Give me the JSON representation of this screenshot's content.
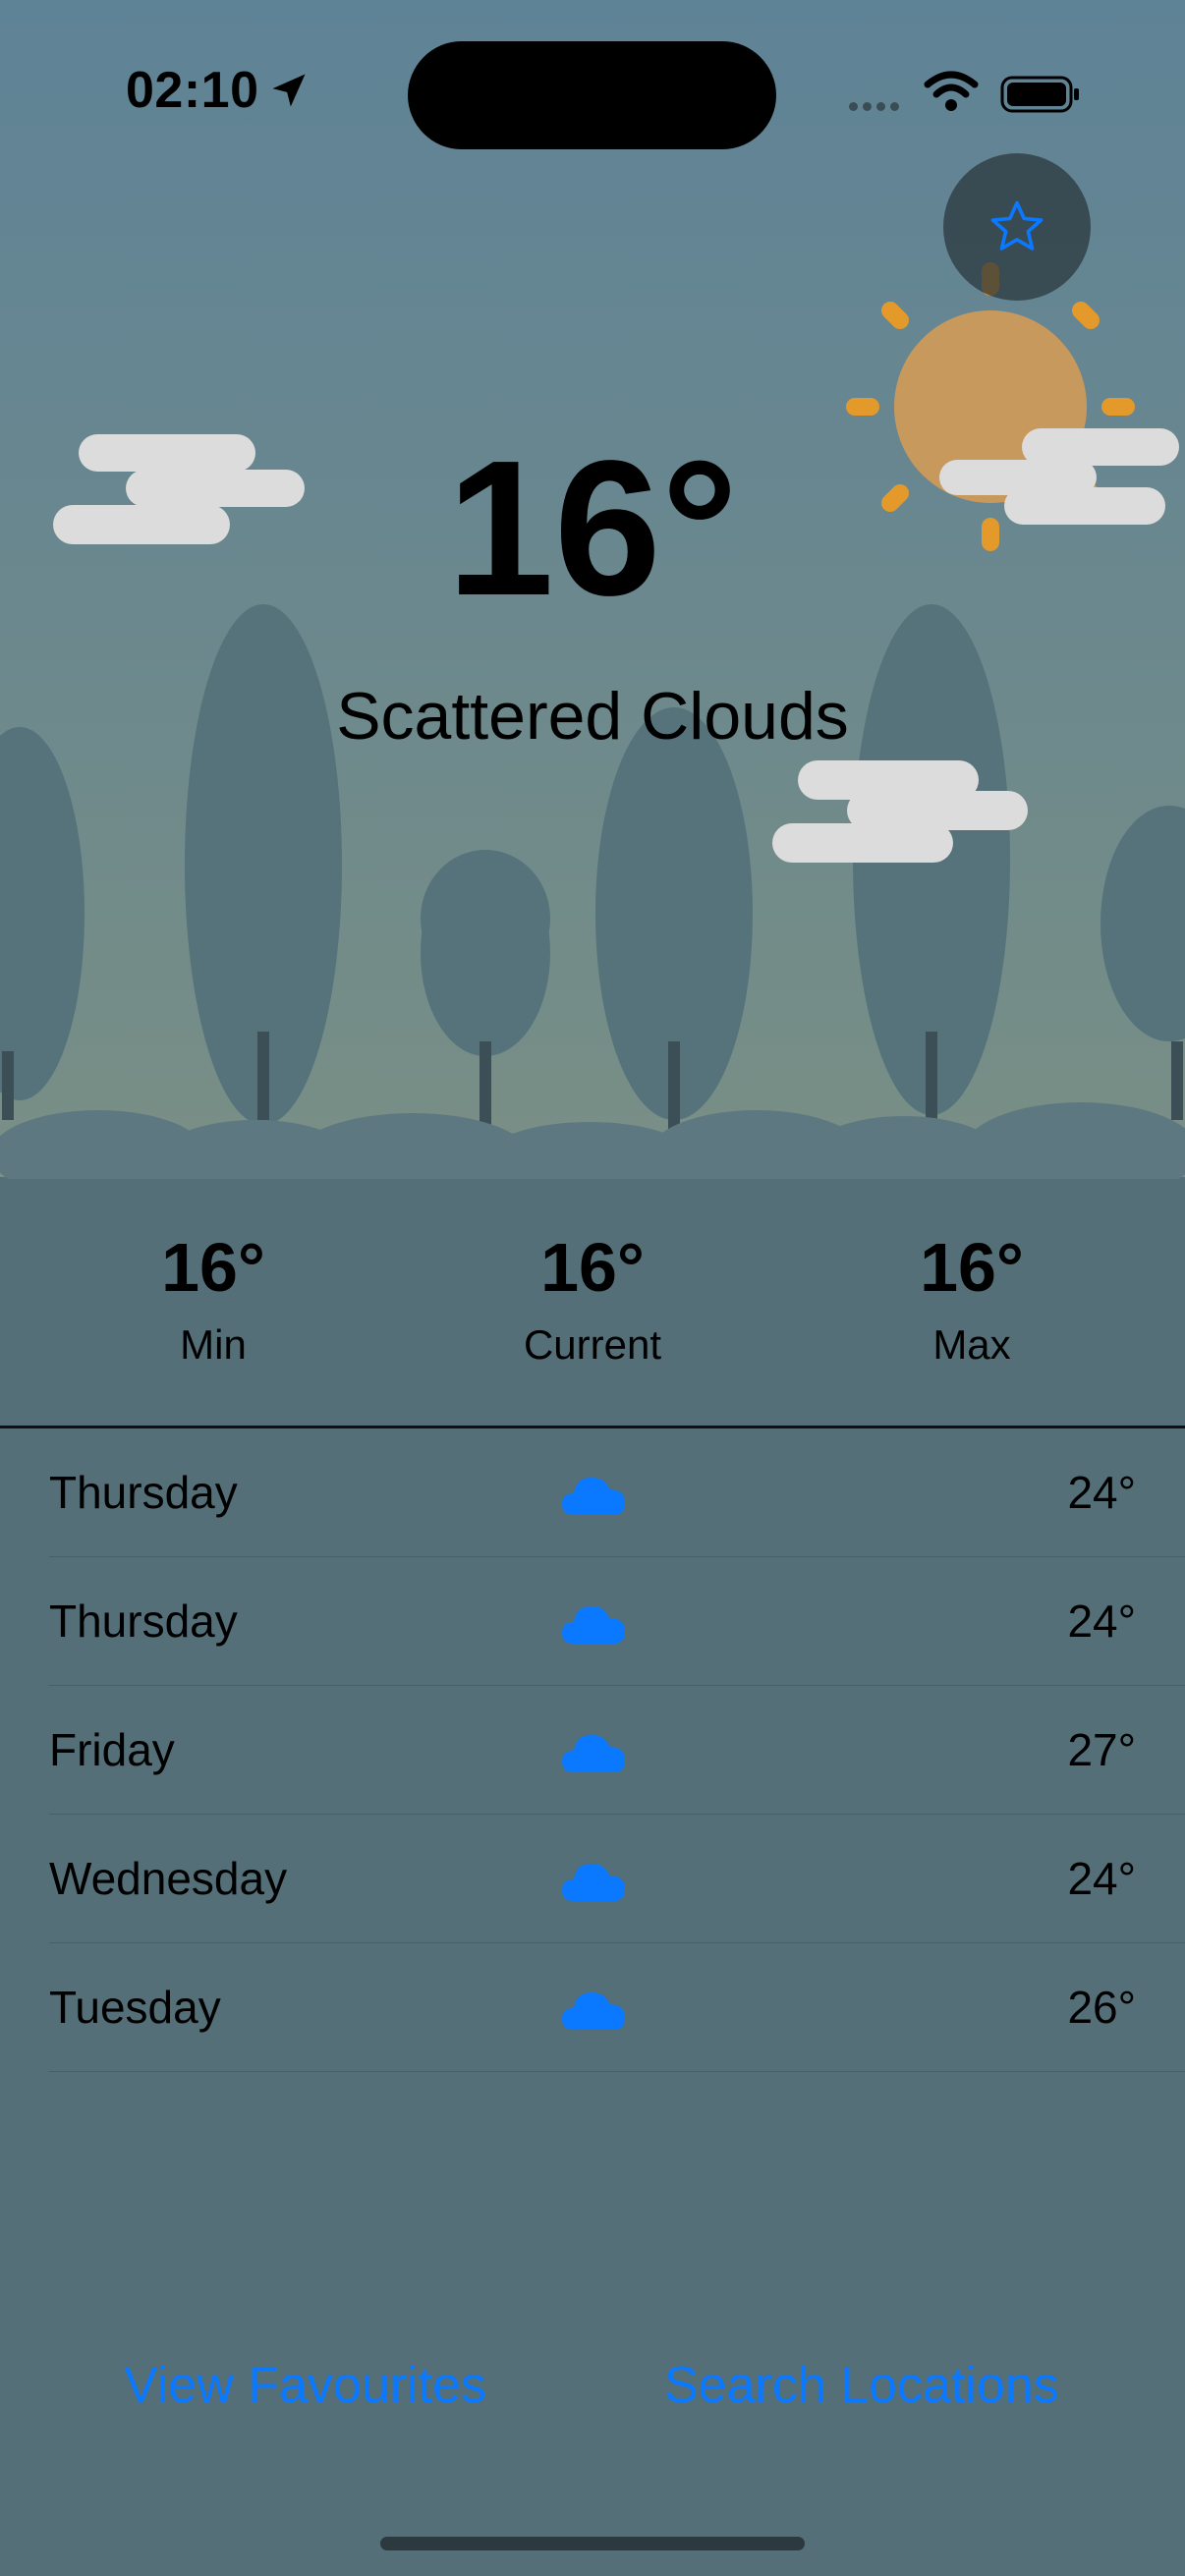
{
  "status_bar": {
    "time": "02:10",
    "icons": [
      "location-arrow-icon",
      "signal-icon",
      "wifi-icon",
      "battery-icon"
    ]
  },
  "favourite_button": {
    "icon": "star-icon",
    "color": "#0a78ff"
  },
  "current": {
    "temperature": "16°",
    "condition": "Scattered Clouds"
  },
  "stats": [
    {
      "value": "16°",
      "label": "Min"
    },
    {
      "value": "16°",
      "label": "Current"
    },
    {
      "value": "16°",
      "label": "Max"
    }
  ],
  "forecast": [
    {
      "day": "Thursday",
      "icon": "cloud-icon",
      "temp": "24°"
    },
    {
      "day": "Thursday",
      "icon": "cloud-icon",
      "temp": "24°"
    },
    {
      "day": "Friday",
      "icon": "cloud-icon",
      "temp": "27°"
    },
    {
      "day": "Wednesday",
      "icon": "cloud-icon",
      "temp": "24°"
    },
    {
      "day": "Tuesday",
      "icon": "cloud-icon",
      "temp": "26°"
    }
  ],
  "bottom_bar": {
    "view_favourites": "View Favourites",
    "search_locations": "Search Locations"
  },
  "colors": {
    "accent": "#0a78ff",
    "background": "#546f78",
    "sun": "#e39a2b"
  }
}
